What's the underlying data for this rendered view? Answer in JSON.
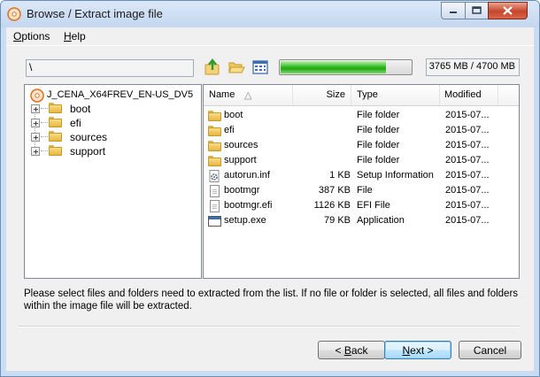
{
  "window": {
    "title": "Browse / Extract image file",
    "controls": {
      "minimize": "minimize-icon",
      "maximize": "maximize-icon",
      "close": "close-icon"
    }
  },
  "menu": {
    "options": {
      "underlined": "O",
      "rest": "ptions"
    },
    "help": {
      "underlined": "H",
      "rest": "elp"
    }
  },
  "toolbar": {
    "path": "\\",
    "icons": [
      "up-folder-icon",
      "open-folder-icon",
      "view-mode-icon"
    ],
    "progress_fraction": 0.8,
    "progress_color": "#22a514",
    "size_text": "3765 MB / 4700 MB"
  },
  "tree": {
    "root": "J_CENA_X64FREV_EN-US_DV5",
    "nodes": [
      "boot",
      "efi",
      "sources",
      "support"
    ]
  },
  "list": {
    "columns": {
      "name": "Name",
      "size": "Size",
      "type": "Type",
      "modified": "Modified"
    },
    "rows": [
      {
        "icon": "folder-icon",
        "name": "boot",
        "size": "",
        "type": "File folder",
        "modified": "2015-07..."
      },
      {
        "icon": "folder-icon",
        "name": "efi",
        "size": "",
        "type": "File folder",
        "modified": "2015-07..."
      },
      {
        "icon": "folder-icon",
        "name": "sources",
        "size": "",
        "type": "File folder",
        "modified": "2015-07..."
      },
      {
        "icon": "folder-icon",
        "name": "support",
        "size": "",
        "type": "File folder",
        "modified": "2015-07..."
      },
      {
        "icon": "settings-file-icon",
        "name": "autorun.inf",
        "size": "1 KB",
        "type": "Setup Information",
        "modified": "2015-07..."
      },
      {
        "icon": "file-icon",
        "name": "bootmgr",
        "size": "387 KB",
        "type": "File",
        "modified": "2015-07..."
      },
      {
        "icon": "file-icon",
        "name": "bootmgr.efi",
        "size": "1126 KB",
        "type": "EFI File",
        "modified": "2015-07..."
      },
      {
        "icon": "application-icon",
        "name": "setup.exe",
        "size": "79 KB",
        "type": "Application",
        "modified": "2015-07..."
      }
    ]
  },
  "instructions": {
    "line1": "Please select files and folders need to extracted from the list. If no file or folder is selected, all files and folders",
    "line2": "within the image file will be extracted."
  },
  "buttons": {
    "back": {
      "prefix": "< ",
      "underlined": "B",
      "rest": "ack"
    },
    "next": {
      "underlined": "N",
      "rest": "ext >"
    },
    "cancel": "Cancel"
  }
}
